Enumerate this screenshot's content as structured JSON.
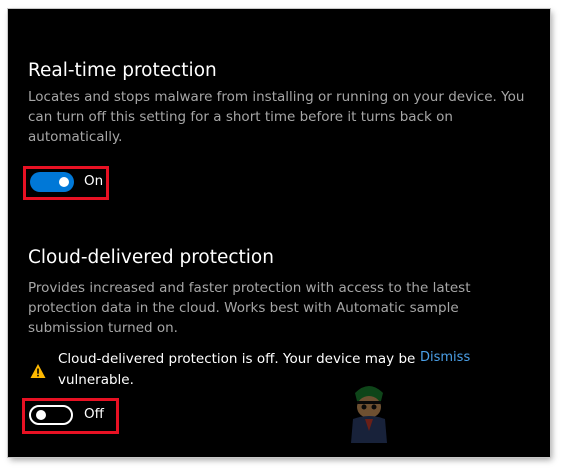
{
  "realtime": {
    "title": "Real-time protection",
    "description": "Locates and stops malware from installing or running on your device. You can turn off this setting for a short time before it turns back on automatically.",
    "toggle_state": "On",
    "toggle_on": true
  },
  "cloud": {
    "title": "Cloud-delivered protection",
    "description": "Provides increased and faster protection with access to the latest protection data in the cloud. Works best with Automatic sample submission turned on.",
    "warning_text": "Cloud-delivered protection is off. Your device may be vulnerable.",
    "dismiss_label": "Dismiss",
    "toggle_state": "Off",
    "toggle_on": false
  },
  "colors": {
    "background": "#000000",
    "accent": "#0078d7",
    "highlight": "#e81123",
    "warning": "#ffb900",
    "link": "#4ba0e8",
    "description_text": "#a6a6a6"
  },
  "icons": {
    "warning": "warning-triangle-icon",
    "watermark": "appuals-mascot-watermark"
  }
}
